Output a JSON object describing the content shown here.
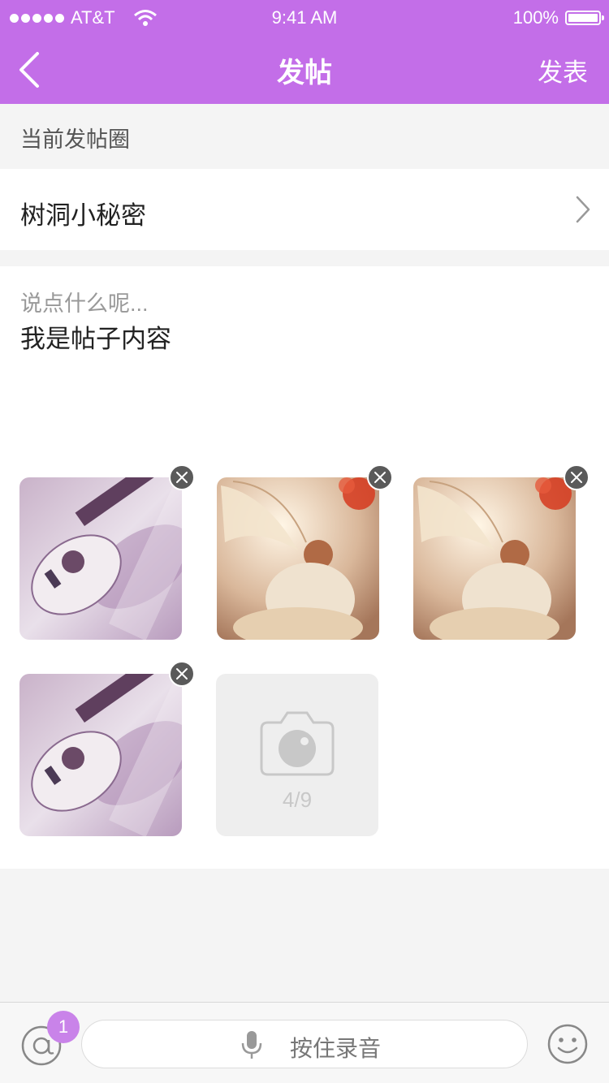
{
  "status_bar": {
    "carrier": "AT&T",
    "time": "9:41 AM",
    "battery": "100%"
  },
  "nav": {
    "title": "发帖",
    "publish_label": "发表"
  },
  "circle": {
    "section_label": "当前发帖圈",
    "name": "树洞小秘密"
  },
  "post": {
    "placeholder": "说点什么呢...",
    "text": "我是帖子内容"
  },
  "photos": {
    "items": [
      {
        "icon": "ukulele-photo"
      },
      {
        "icon": "fairy-photo"
      },
      {
        "icon": "fairy-photo"
      },
      {
        "icon": "ukulele-photo"
      }
    ],
    "count_label": "4/9"
  },
  "bottom_bar": {
    "mention_badge": "1",
    "voice_label": "按住录音"
  },
  "colors": {
    "accent": "#c36ee8",
    "badge": "#c983e9"
  }
}
